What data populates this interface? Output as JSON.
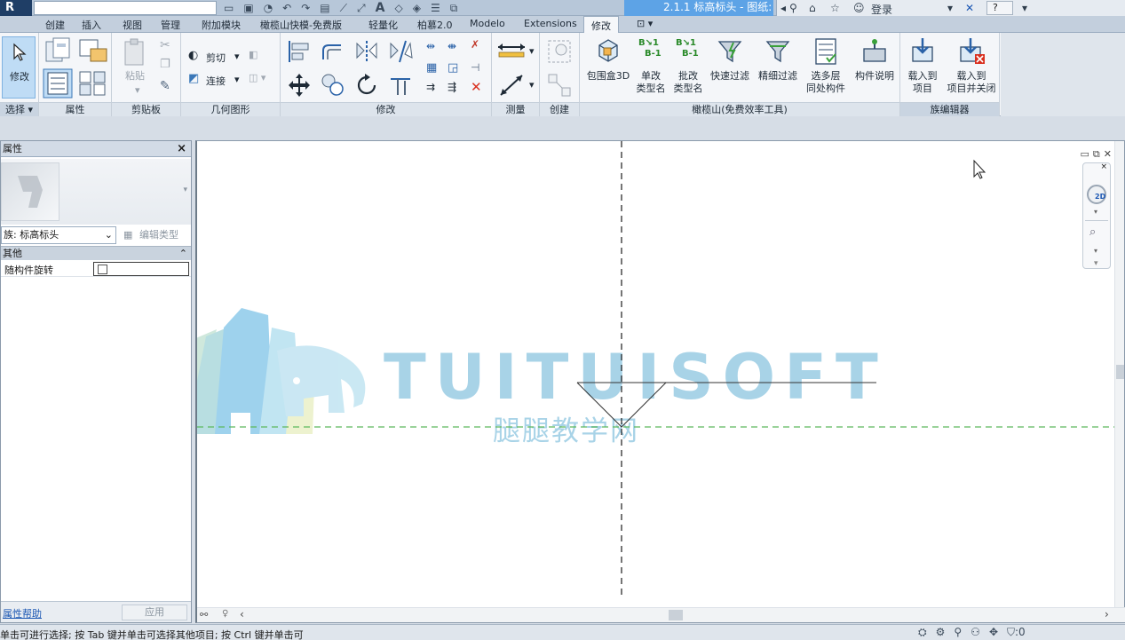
{
  "quick_access": {
    "doc_title": "2.1.1 标高标头 - 图纸:",
    "search_icon_name": "binoculars-icon",
    "login_label": "登录",
    "help_label": "?"
  },
  "tabs": [
    "创建",
    "插入",
    "视图",
    "管理",
    "附加模块",
    "橄榄山快模-免费版",
    "轻量化",
    "柏慕2.0",
    "Modelo",
    "Extensions",
    "修改"
  ],
  "active_tab": "修改",
  "ribbon": {
    "select": {
      "button": "修改",
      "label": "选择"
    },
    "properties": {
      "label": "属性"
    },
    "clipboard": {
      "paste": "粘贴",
      "label": "剪贴板"
    },
    "geometry": {
      "cut": "剪切",
      "join": "连接",
      "label": "几何图形"
    },
    "modify": {
      "label": "修改"
    },
    "measure": {
      "label": "测量"
    },
    "create": {
      "label": "创建"
    },
    "olive": {
      "buttons": [
        {
          "l1": "包围盒3D",
          "l2": ""
        },
        {
          "l1": "单改",
          "l2": "类型名"
        },
        {
          "l1": "批改",
          "l2": "类型名"
        },
        {
          "l1": "快速过滤",
          "l2": ""
        },
        {
          "l1": "精细过滤",
          "l2": ""
        },
        {
          "l1": "选多层",
          "l2": "同处构件"
        },
        {
          "l1": "构件说明",
          "l2": ""
        }
      ],
      "label": "橄榄山(免费效率工具)"
    },
    "family_editor": {
      "buttons": [
        {
          "l1": "载入到",
          "l2": "项目"
        },
        {
          "l1": "载入到",
          "l2": "项目并关闭"
        }
      ],
      "label": "族编辑器"
    }
  },
  "properties": {
    "title": "属性",
    "family_type": "族: 标高标头",
    "edit_type": "编辑类型",
    "group": "其他",
    "param_name": "随构件旋转",
    "param_checked": false,
    "help_link": "属性帮助",
    "apply": "应用"
  },
  "watermark": {
    "brand": "TUITUISOFT",
    "cn": "腿腿教学网"
  },
  "nav_wheel_label": "2D",
  "status_bar": {
    "text": "单击可进行选择; 按 Tab 键并单击可选择其他项目; 按 Ctrl 键并单击可"
  },
  "colors": {
    "accent_title": "#5da3e6",
    "ref_plane_green": "#5cb85c",
    "watermark_blue": "#6fb6d8"
  }
}
